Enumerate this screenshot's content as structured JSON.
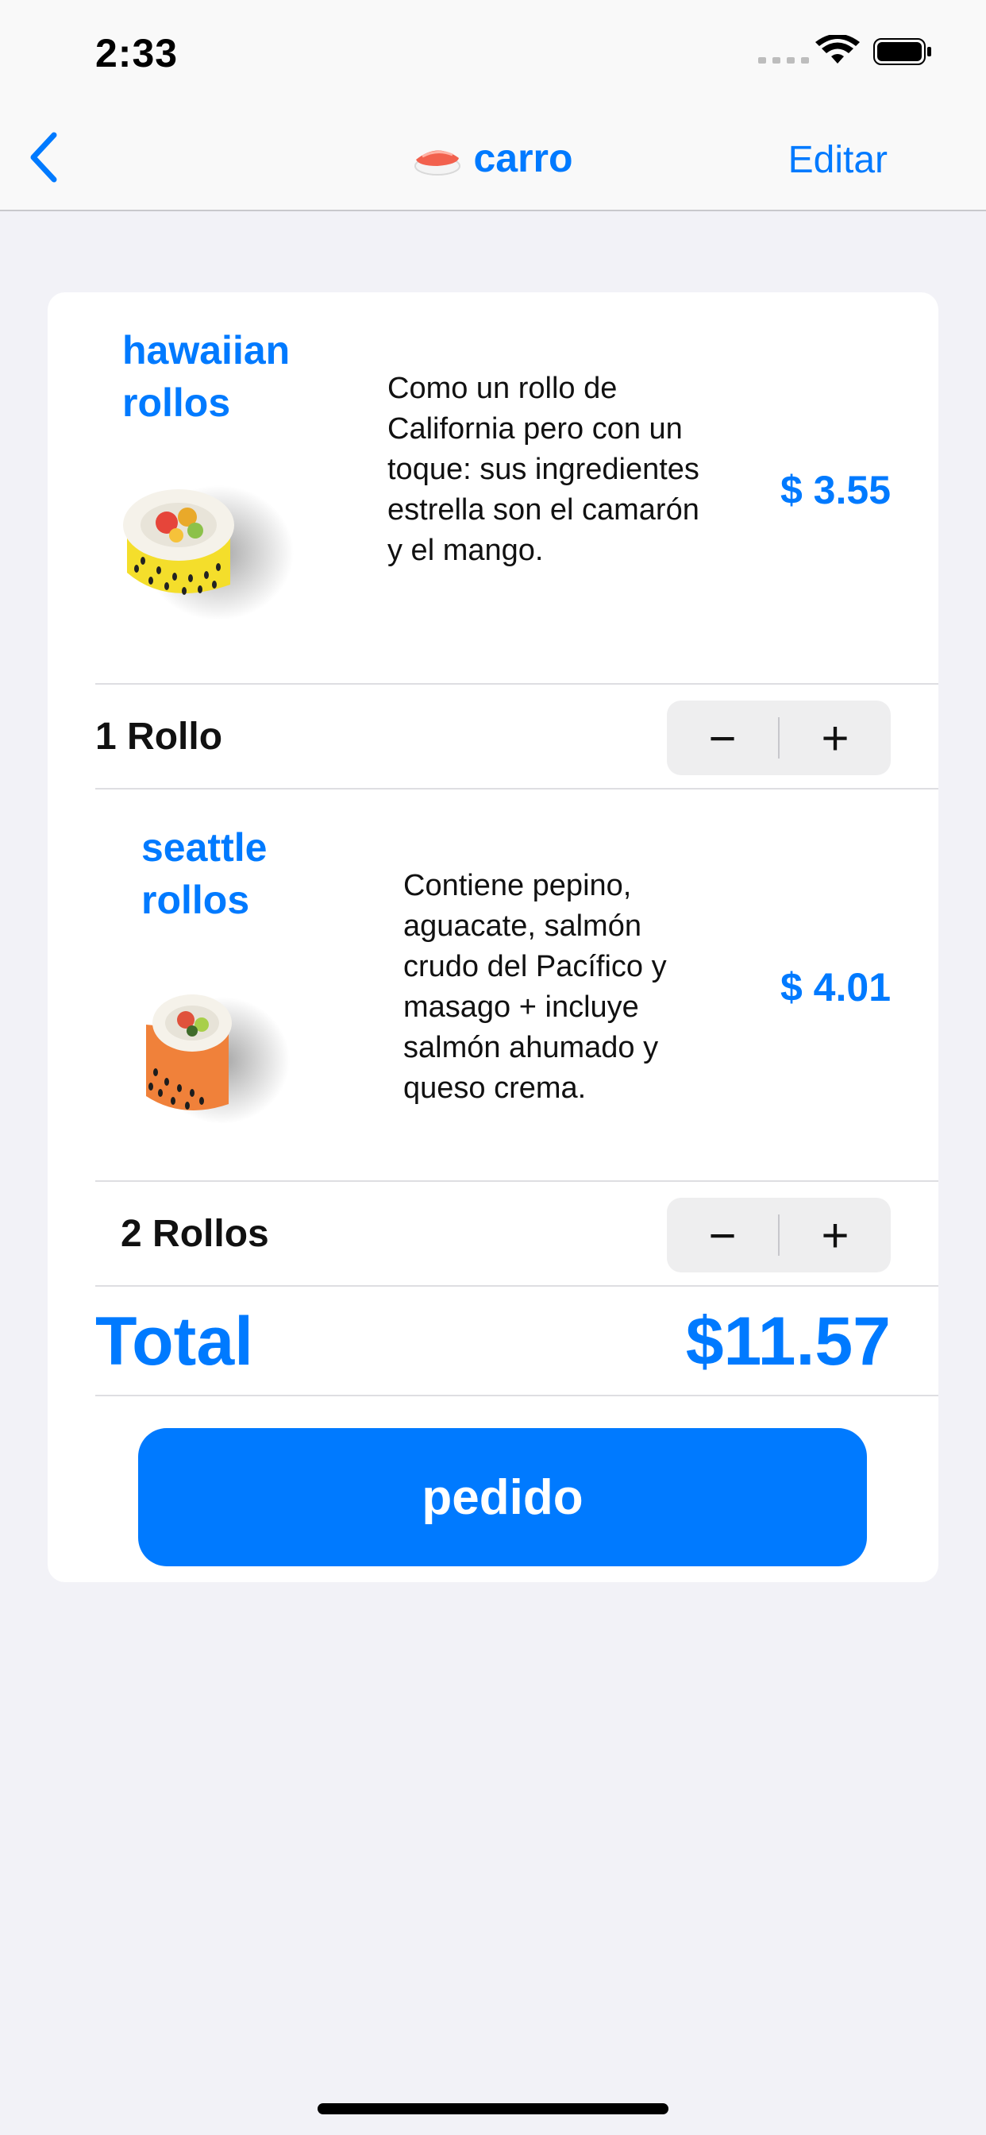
{
  "status": {
    "time": "2:33"
  },
  "nav": {
    "title": "carro",
    "edit_label": "Editar"
  },
  "items": [
    {
      "name_line1": "hawaiian",
      "name_line2": "rollos",
      "description": "Como un rollo de California pero con un toque: sus ingredientes estrella son el camarón y el mango.",
      "price": "$ 3.55",
      "quantity": "1 Rollo",
      "minus": "−",
      "plus": "+"
    },
    {
      "name_line1": "seattle",
      "name_line2": "rollos",
      "description": "Contiene pepino, aguacate, salmón crudo del Pacífico y masago + incluye salmón ahumado y queso crema.",
      "price": "$ 4.01",
      "quantity": "2 Rollos",
      "minus": "−",
      "plus": "+"
    }
  ],
  "total": {
    "label": "Total",
    "value": "$11.57"
  },
  "order_button": "pedido",
  "colors": {
    "accent": "#007aff",
    "background": "#f2f2f7"
  }
}
